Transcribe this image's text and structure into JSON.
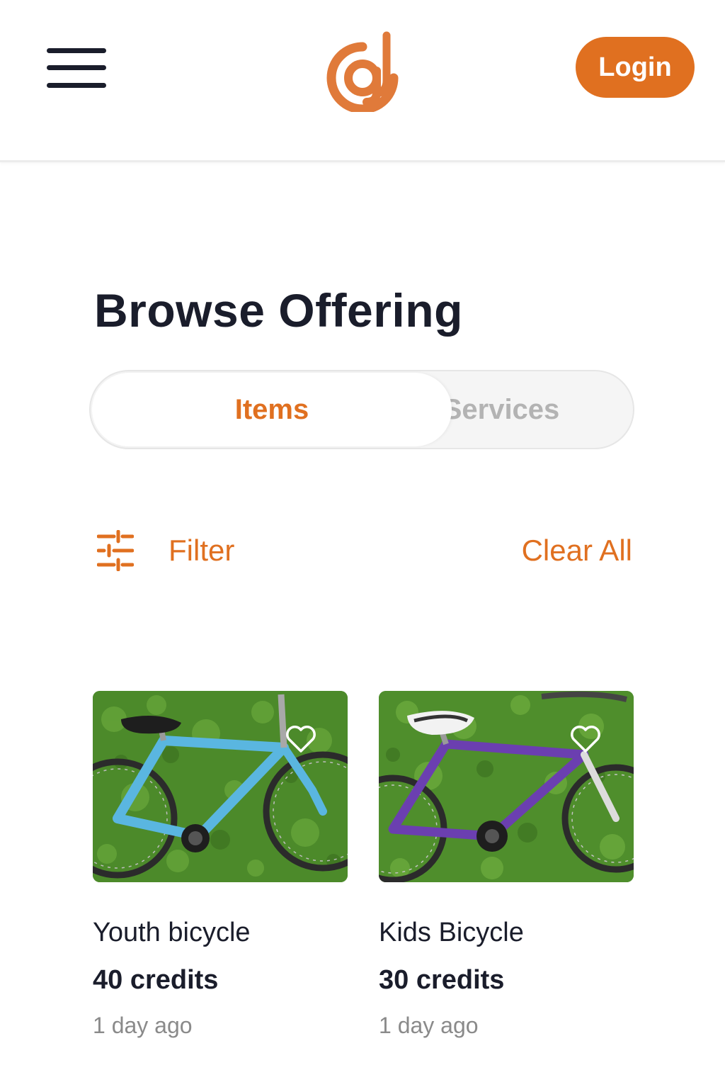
{
  "header": {
    "login_label": "Login",
    "menu_icon": "hamburger-menu-icon",
    "logo_icon": "brand-logo"
  },
  "page": {
    "title": "Browse Offering"
  },
  "tabs": [
    {
      "label": "Items",
      "selected": true
    },
    {
      "label": "Services",
      "selected": false
    }
  ],
  "filter": {
    "label": "Filter",
    "icon": "sliders-icon",
    "clear_label": "Clear All"
  },
  "listings": [
    {
      "title": "Youth bicycle",
      "price": "40 credits",
      "posted": "1 day ago",
      "icon": "heart-icon"
    },
    {
      "title": "Kids Bicycle",
      "price": "30 credits",
      "posted": "1 day ago",
      "icon": "heart-icon"
    }
  ],
  "colors": {
    "accent": "#e07020",
    "text": "#1a1d2b",
    "muted": "#8a8a8a",
    "inactive_tab": "#b3b3b3"
  }
}
